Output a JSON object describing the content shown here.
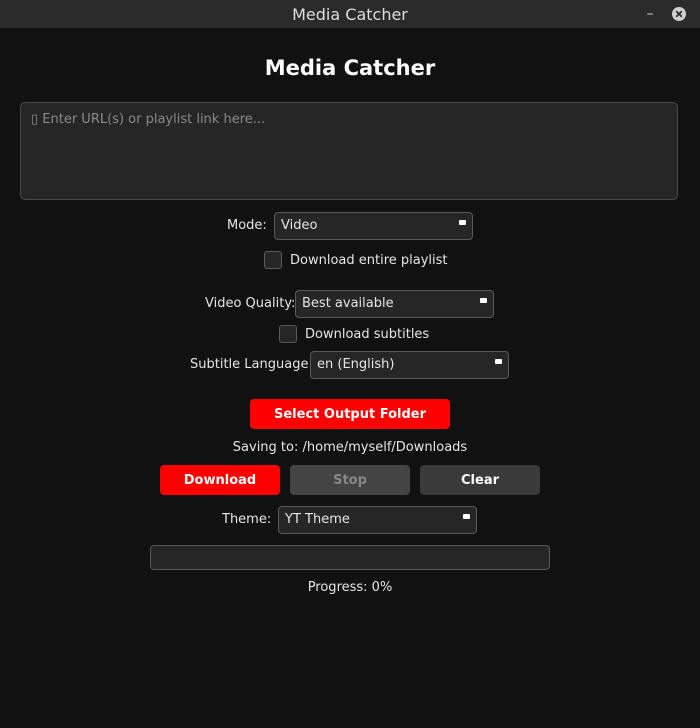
{
  "window": {
    "title": "Media Catcher"
  },
  "heading": "Media Catcher",
  "url_input": {
    "placeholder": "▯ Enter URL(s) or playlist link here..."
  },
  "mode": {
    "label": "Mode:",
    "value": "Video"
  },
  "playlist_checkbox": {
    "label": "Download entire playlist",
    "checked": false
  },
  "video_quality": {
    "label": "Video Quality:",
    "value": "Best available"
  },
  "subtitles_checkbox": {
    "label": "Download subtitles",
    "checked": false
  },
  "subtitle_language": {
    "label": "Subtitle Language:",
    "value": "en (English)"
  },
  "output_folder_button": "Select Output Folder",
  "saving_to": "Saving to: /home/myself/Downloads",
  "actions": {
    "download": "Download",
    "stop": "Stop",
    "clear": "Clear"
  },
  "theme": {
    "label": "Theme:",
    "value": "YT Theme"
  },
  "progress": {
    "value": 0,
    "text": "Progress: 0%"
  },
  "colors": {
    "accent": "#ff0000",
    "background": "#111111",
    "titlebar": "#2b2b2b"
  }
}
